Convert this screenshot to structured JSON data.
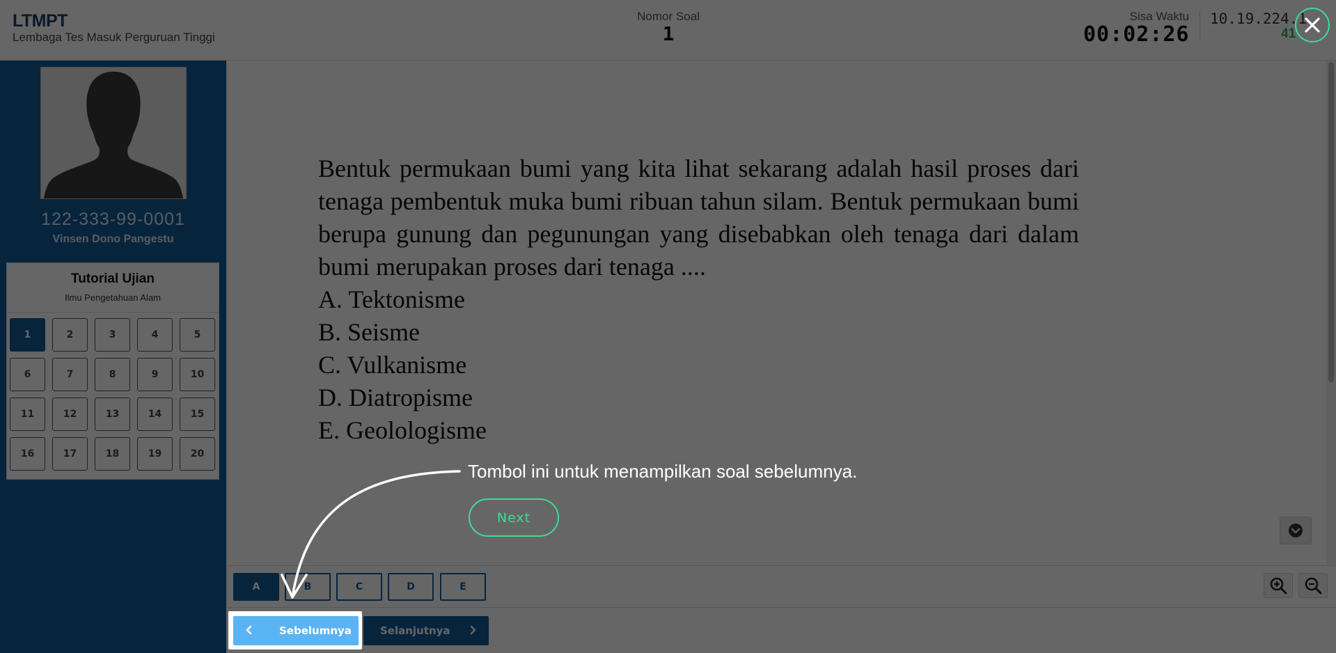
{
  "header": {
    "brand_title": "LTMPT",
    "brand_subtitle": "Lembaga Tes Masuk Perguruan Tinggi",
    "question_number_label": "Nomor Soal",
    "question_number": "1",
    "timer_label": "Sisa Waktu",
    "timer_value": "00:02:26",
    "ip_address": "10.19.224.1",
    "ping": "41"
  },
  "sidebar": {
    "avatar_icon": "user-silhouette-icon",
    "participant_id": "122-333-99-0001",
    "participant_name": "Vinsen Dono Pangestu",
    "panel_title": "Tutorial Ujian",
    "panel_subtitle": "Ilmu Pengetahuan Alam",
    "question_buttons": [
      "1",
      "2",
      "3",
      "4",
      "5",
      "6",
      "7",
      "8",
      "9",
      "10",
      "11",
      "12",
      "13",
      "14",
      "15",
      "16",
      "17",
      "18",
      "19",
      "20"
    ],
    "active_question": "1"
  },
  "question": {
    "text": "Bentuk permukaan bumi yang kita lihat sekarang adalah hasil proses dari tenaga pembentuk muka bumi ribuan tahun silam. Bentuk permukaan bumi berupa gunung dan pegunungan yang disebabkan oleh tenaga dari dalam bumi merupakan proses dari tenaga ....",
    "options": [
      "A. Tektonisme",
      "B. Seisme",
      "C. Vulkanisme",
      "D. Diatropisme",
      "E. Geolologisme"
    ]
  },
  "answers": {
    "choices": [
      "A",
      "B",
      "C",
      "D",
      "E"
    ],
    "selected": "A"
  },
  "navigation": {
    "prev_label": "Sebelumnya",
    "next_label": "Selanjutnya"
  },
  "tutorial": {
    "tip_text": "Tombol ini untuk menampilkan soal sebelumnya.",
    "next_label": "Next",
    "close_icon": "close-icon"
  },
  "colors": {
    "primary": "#135a98",
    "prev_button": "#5ab4f4",
    "accent_green": "#3ddc97",
    "ping_green": "#27b35f"
  }
}
